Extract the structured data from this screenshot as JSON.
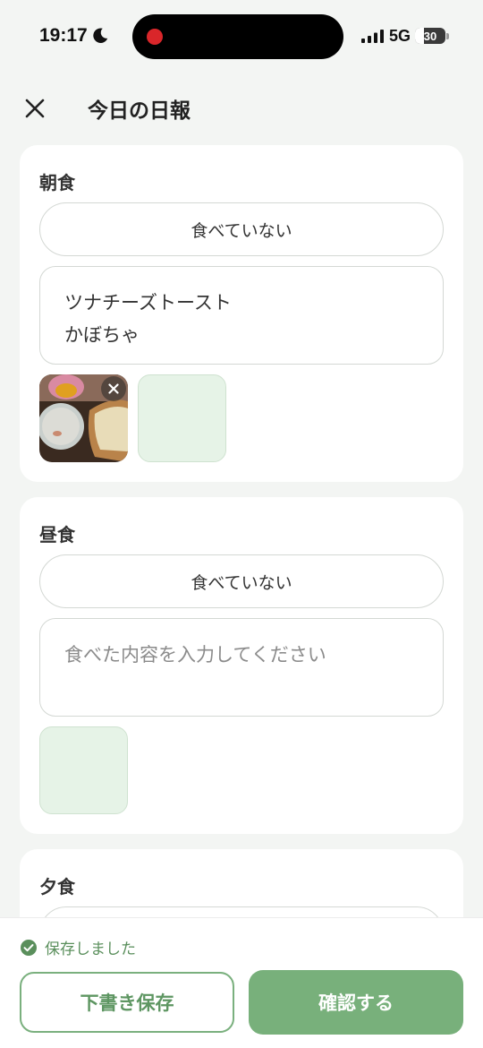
{
  "status_bar": {
    "time": "19:17",
    "network": "5G",
    "battery": "30"
  },
  "header": {
    "title": "今日の日報"
  },
  "meals": [
    {
      "title": "朝食",
      "not_eaten_label": "食べていない",
      "text": "ツナチーズトースト\nかぼちゃ",
      "placeholder": "食べた内容を入力してください"
    },
    {
      "title": "昼食",
      "not_eaten_label": "食べていない",
      "text": "",
      "placeholder": "食べた内容を入力してください"
    },
    {
      "title": "夕食"
    }
  ],
  "footer": {
    "saved_status": "保存しました",
    "draft_button": "下書き保存",
    "confirm_button": "確認する"
  },
  "colors": {
    "accent": "#78b07b",
    "accent_text": "#5e9662",
    "photo_placeholder": "#e6f3e7",
    "background": "#f3f5f3"
  }
}
